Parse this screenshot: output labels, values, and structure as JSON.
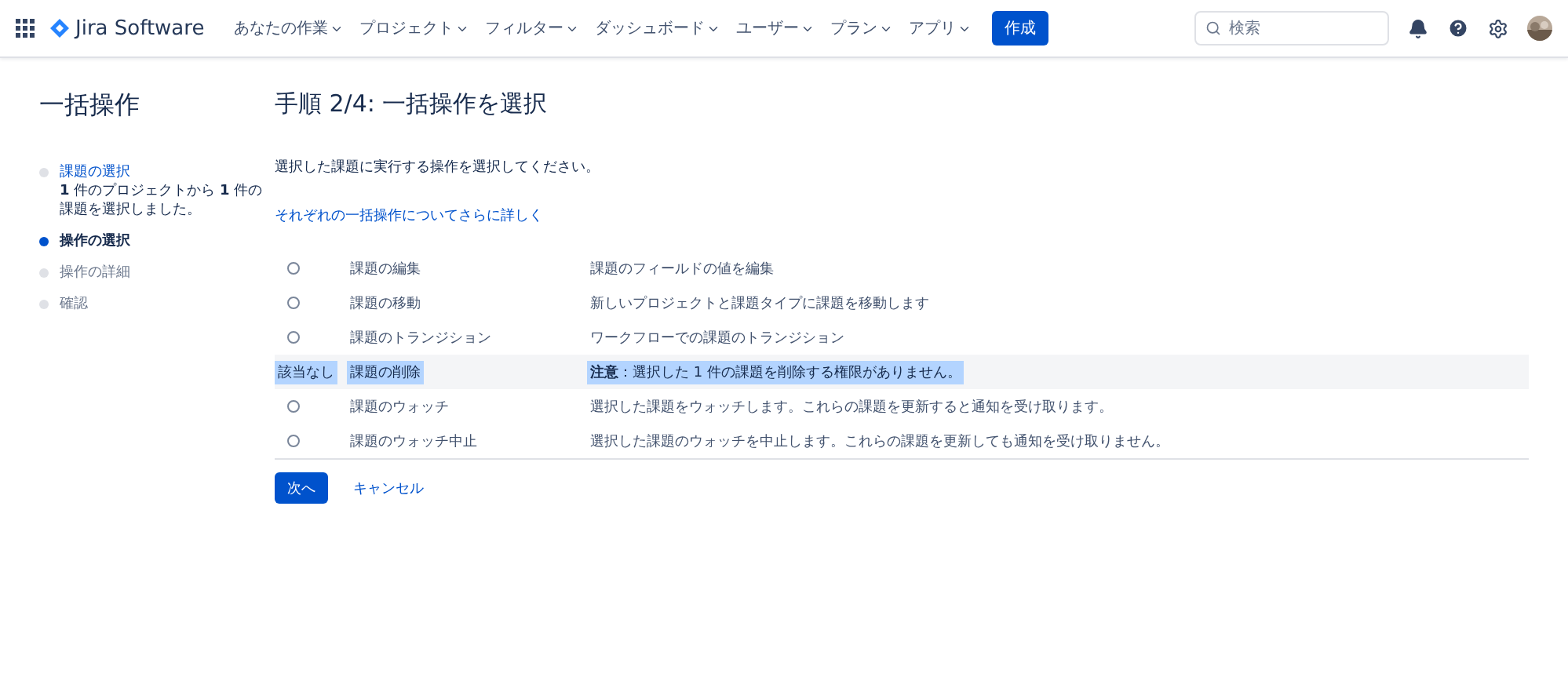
{
  "nav": {
    "logo": "Jira Software",
    "menus": [
      {
        "label": "あなたの作業"
      },
      {
        "label": "プロジェクト"
      },
      {
        "label": "フィルター"
      },
      {
        "label": "ダッシュボード"
      },
      {
        "label": "ユーザー"
      },
      {
        "label": "プラン"
      },
      {
        "label": "アプリ"
      }
    ],
    "create_button": "作成",
    "search": {
      "placeholder": "検索"
    }
  },
  "sidebar": {
    "title": "一括操作",
    "steps": [
      {
        "label": "課題の選択",
        "completed": true,
        "current": false,
        "detail": "**1** 件のプロジェクトから **1** 件の課題を選択しました。"
      },
      {
        "label": "操作の選択",
        "completed": false,
        "current": true
      },
      {
        "label": "操作の詳細",
        "completed": false,
        "current": false
      },
      {
        "label": "確認",
        "completed": false,
        "current": false
      }
    ]
  },
  "main": {
    "title": "手順 2/4: 一括操作を選択",
    "instruction": "選択した課題に実行する操作を選択してください。",
    "help_link": "それぞれの一括操作についてさらに詳しく",
    "operations": [
      {
        "kind": "radio",
        "selected": false,
        "name": "課題の編集",
        "description": "課題のフィールドの値を編集"
      },
      {
        "kind": "radio",
        "selected": false,
        "name": "課題の移動",
        "description": "新しいプロジェクトと課題タイプに課題を移動します"
      },
      {
        "kind": "radio",
        "selected": false,
        "name": "課題のトランジション",
        "description": "ワークフローでの課題のトランジション"
      },
      {
        "kind": "unavailable",
        "status": "該当なし",
        "highlighted": true,
        "name": "課題の削除",
        "description": "**注意**：選択した 1 件の課題を削除する権限がありません。"
      },
      {
        "kind": "radio",
        "selected": false,
        "name": "課題のウォッチ",
        "description": "選択した課題をウォッチします。これらの課題を更新すると通知を受け取ります。"
      },
      {
        "kind": "radio",
        "selected": false,
        "name": "課題のウォッチ中止",
        "description": "選択した課題のウォッチを中止します。これらの課題を更新しても通知を受け取りません。"
      }
    ],
    "next_button": "次へ",
    "cancel_link": "キャンセル"
  }
}
